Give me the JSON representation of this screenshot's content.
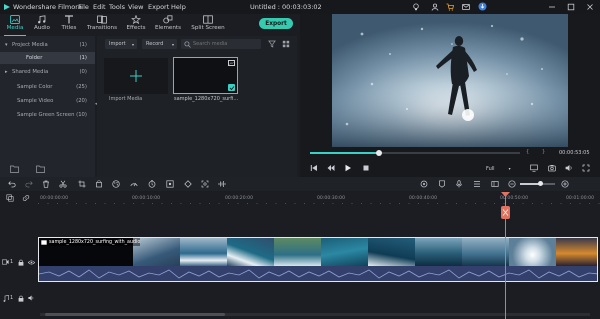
{
  "app": {
    "name": "Wondershare Filmora",
    "menu": [
      "File",
      "Edit",
      "Tools",
      "View",
      "Export",
      "Help"
    ],
    "project_title": "Untitled : 00:03:03:02"
  },
  "toolbar": {
    "tabs": [
      {
        "label": "Media",
        "icon": "media-icon",
        "active": true
      },
      {
        "label": "Audio",
        "icon": "audio-icon"
      },
      {
        "label": "Titles",
        "icon": "titles-icon"
      },
      {
        "label": "Transitions",
        "icon": "transitions-icon"
      },
      {
        "label": "Effects",
        "icon": "effects-icon"
      },
      {
        "label": "Elements",
        "icon": "elements-icon"
      },
      {
        "label": "Split Screen",
        "icon": "split-screen-icon"
      }
    ],
    "export_label": "Export"
  },
  "left_panel": {
    "items": [
      {
        "label": "Project Media",
        "count": "(1)",
        "expanded": true
      },
      {
        "label": "Folder",
        "count": "(1)",
        "selected": true
      },
      {
        "label": "Shared Media",
        "count": "(0)"
      },
      {
        "label": "Sample Color",
        "count": "(25)"
      },
      {
        "label": "Sample Video",
        "count": "(20)"
      },
      {
        "label": "Sample Green Screen",
        "count": "(10)"
      }
    ]
  },
  "media": {
    "import_dropdown": "Import",
    "record_dropdown": "Record",
    "search_placeholder": "Search media",
    "import_tile_label": "Import Media",
    "clip_label": "sample_1280x720_surfi..."
  },
  "preview": {
    "timecode": "00:00:53:05",
    "quality": "Full",
    "playhead_progress": 0.33,
    "marks": [
      "{",
      "}"
    ]
  },
  "timeline": {
    "ruler_labels": [
      "00:00:00:00",
      "00:00:10:00",
      "00:00:20:00",
      "00:00:30:00",
      "00:00:40:00",
      "00:00:50:00",
      "00:01:00:00"
    ],
    "video_clip_label": "sample_1280x720_surfing_with_audio",
    "track_video_label": "1",
    "track_audio_label": "1"
  },
  "colors": {
    "accent": "#39d0c6",
    "playhead": "#e0735f",
    "export_bg": "#35cbb1"
  }
}
